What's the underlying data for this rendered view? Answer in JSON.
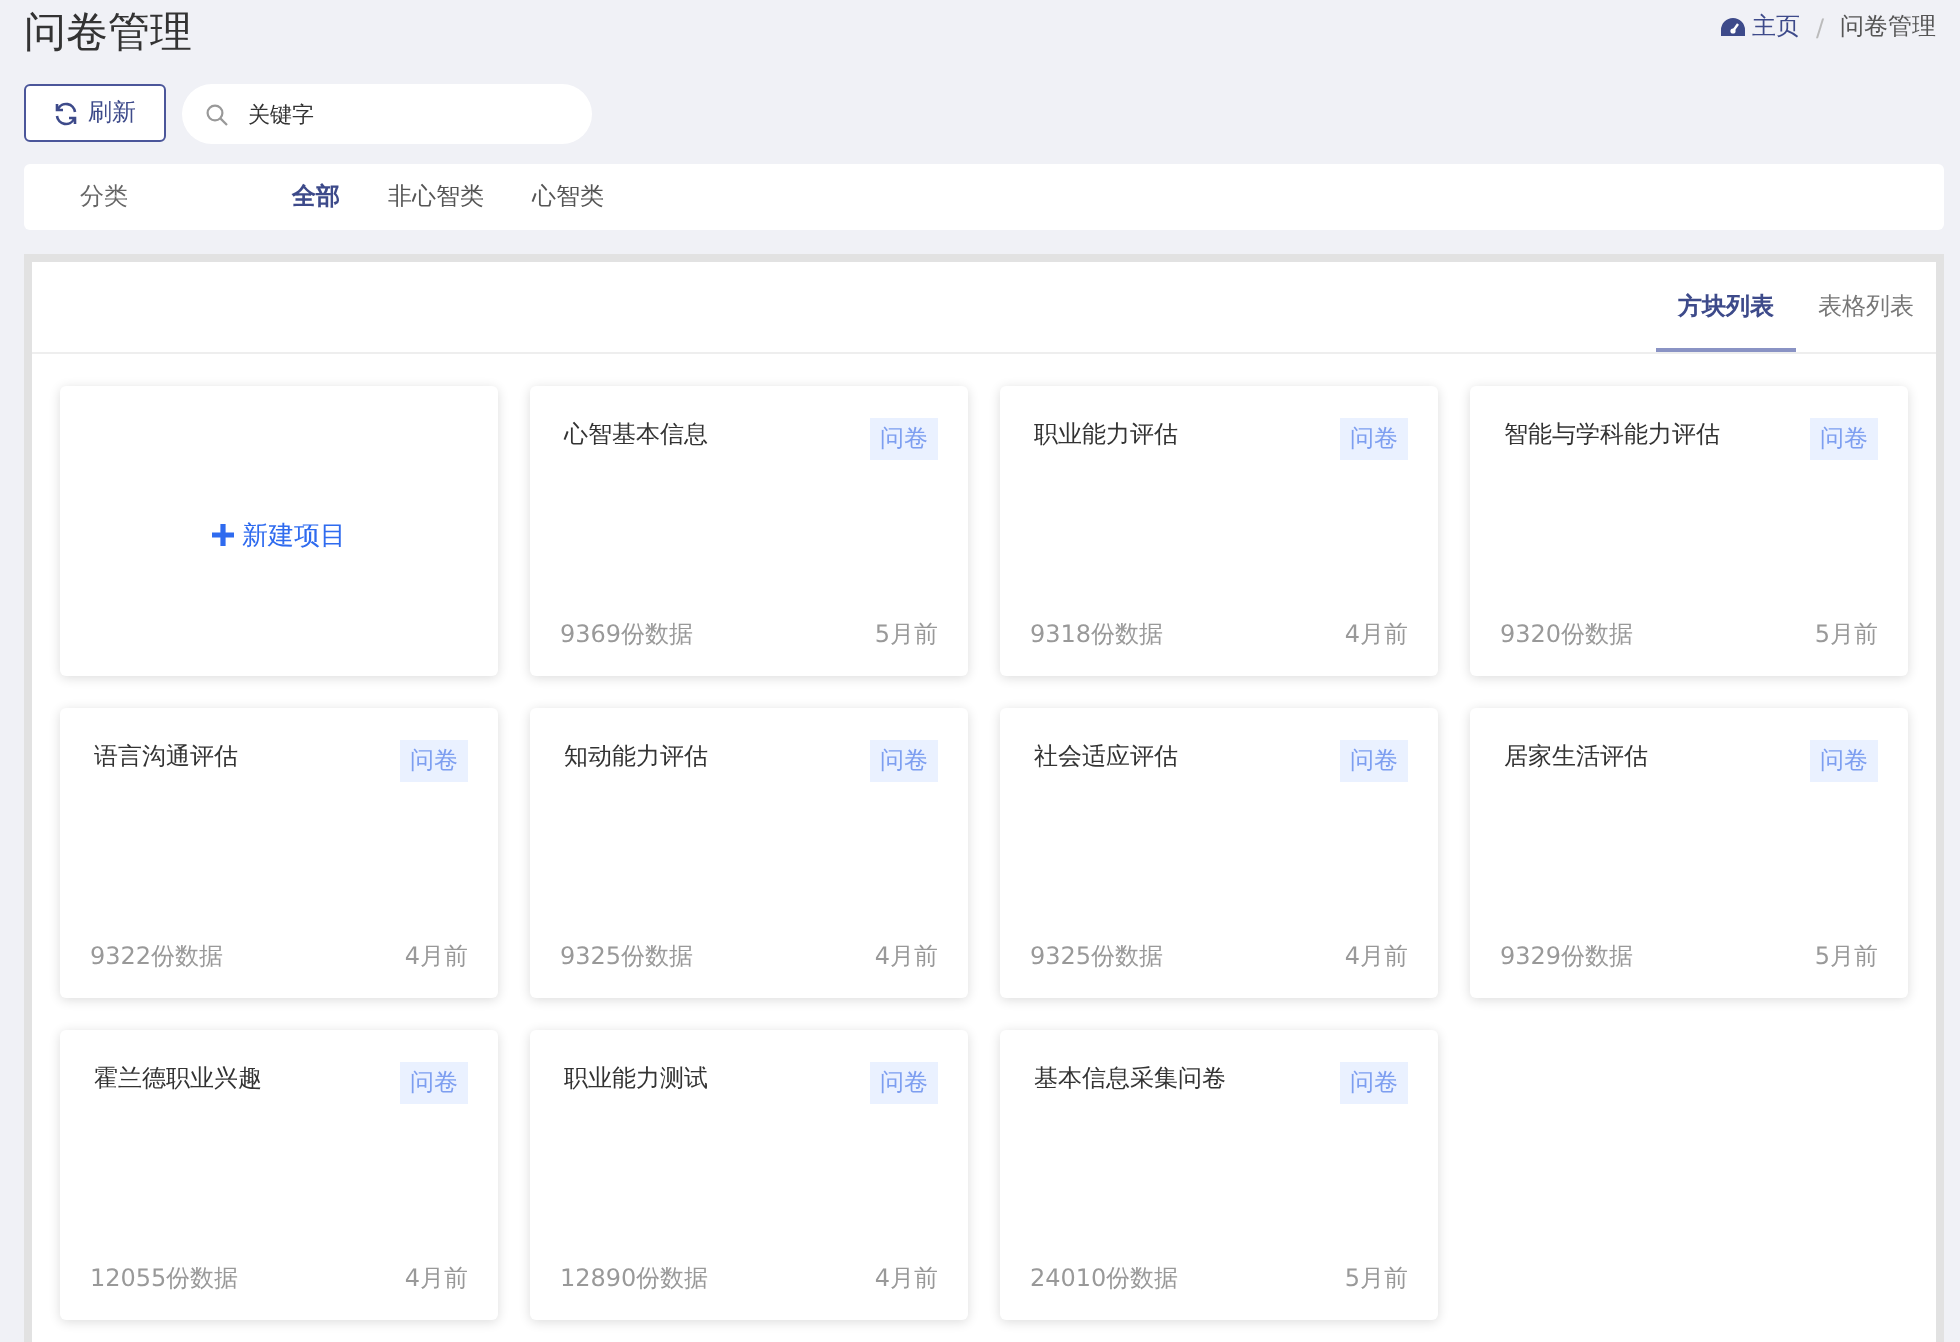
{
  "page_title": "问卷管理",
  "breadcrumb_separator": "/",
  "breadcrumb": [
    {
      "label": "主页",
      "kind": "home"
    },
    {
      "label": "问卷管理",
      "kind": "current"
    }
  ],
  "refresh_button": "刷新",
  "search": {
    "placeholder": "关键字"
  },
  "filter": {
    "label": "分类",
    "options": [
      {
        "label": "全部",
        "selected": true
      },
      {
        "label": "非心智类",
        "selected": false
      },
      {
        "label": "心智类",
        "selected": false
      }
    ]
  },
  "view_tabs": [
    {
      "label": "方块列表",
      "selected": true
    },
    {
      "label": "表格列表",
      "selected": false
    }
  ],
  "new_project": "新建项目",
  "cards": [
    {
      "title": "心智基本信息",
      "tag": "问卷",
      "count": "9369份数据",
      "time": "5月前"
    },
    {
      "title": "职业能力评估",
      "tag": "问卷",
      "count": "9318份数据",
      "time": "4月前"
    },
    {
      "title": "智能与学科能力评估",
      "tag": "问卷",
      "count": "9320份数据",
      "time": "5月前"
    },
    {
      "title": "语言沟通评估",
      "tag": "问卷",
      "count": "9322份数据",
      "time": "4月前"
    },
    {
      "title": "知动能力评估",
      "tag": "问卷",
      "count": "9325份数据",
      "time": "4月前"
    },
    {
      "title": "社会适应评估",
      "tag": "问卷",
      "count": "9325份数据",
      "time": "4月前"
    },
    {
      "title": "居家生活评估",
      "tag": "问卷",
      "count": "9329份数据",
      "time": "5月前"
    },
    {
      "title": "霍兰德职业兴趣",
      "tag": "问卷",
      "count": "12055份数据",
      "time": "4月前"
    },
    {
      "title": "职业能力测试",
      "tag": "问卷",
      "count": "12890份数据",
      "time": "4月前"
    },
    {
      "title": "基本信息采集问卷",
      "tag": "问卷",
      "count": "24010份数据",
      "time": "5月前"
    }
  ]
}
